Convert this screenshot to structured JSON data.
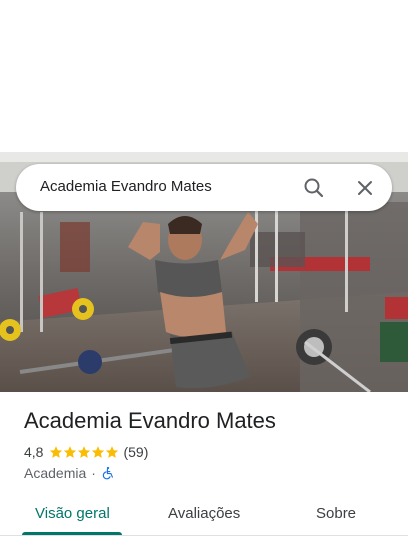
{
  "search": {
    "query": "Academia Evandro Mates"
  },
  "place": {
    "name": "Academia Evandro Mates",
    "rating": "4,8",
    "reviews_count": "(59)",
    "stars": 5,
    "category": "Academia",
    "separator": "·"
  },
  "tabs": [
    {
      "label": "Visão geral",
      "active": true
    },
    {
      "label": "Avaliações",
      "active": false
    },
    {
      "label": "Sobre",
      "active": false
    }
  ],
  "colors": {
    "accent": "#01766a",
    "star": "#fbbc04",
    "accessibility": "#1a73e8"
  },
  "icons": {
    "search": "search-icon",
    "close": "close-icon",
    "star": "star-icon",
    "accessibility": "wheelchair-icon"
  }
}
